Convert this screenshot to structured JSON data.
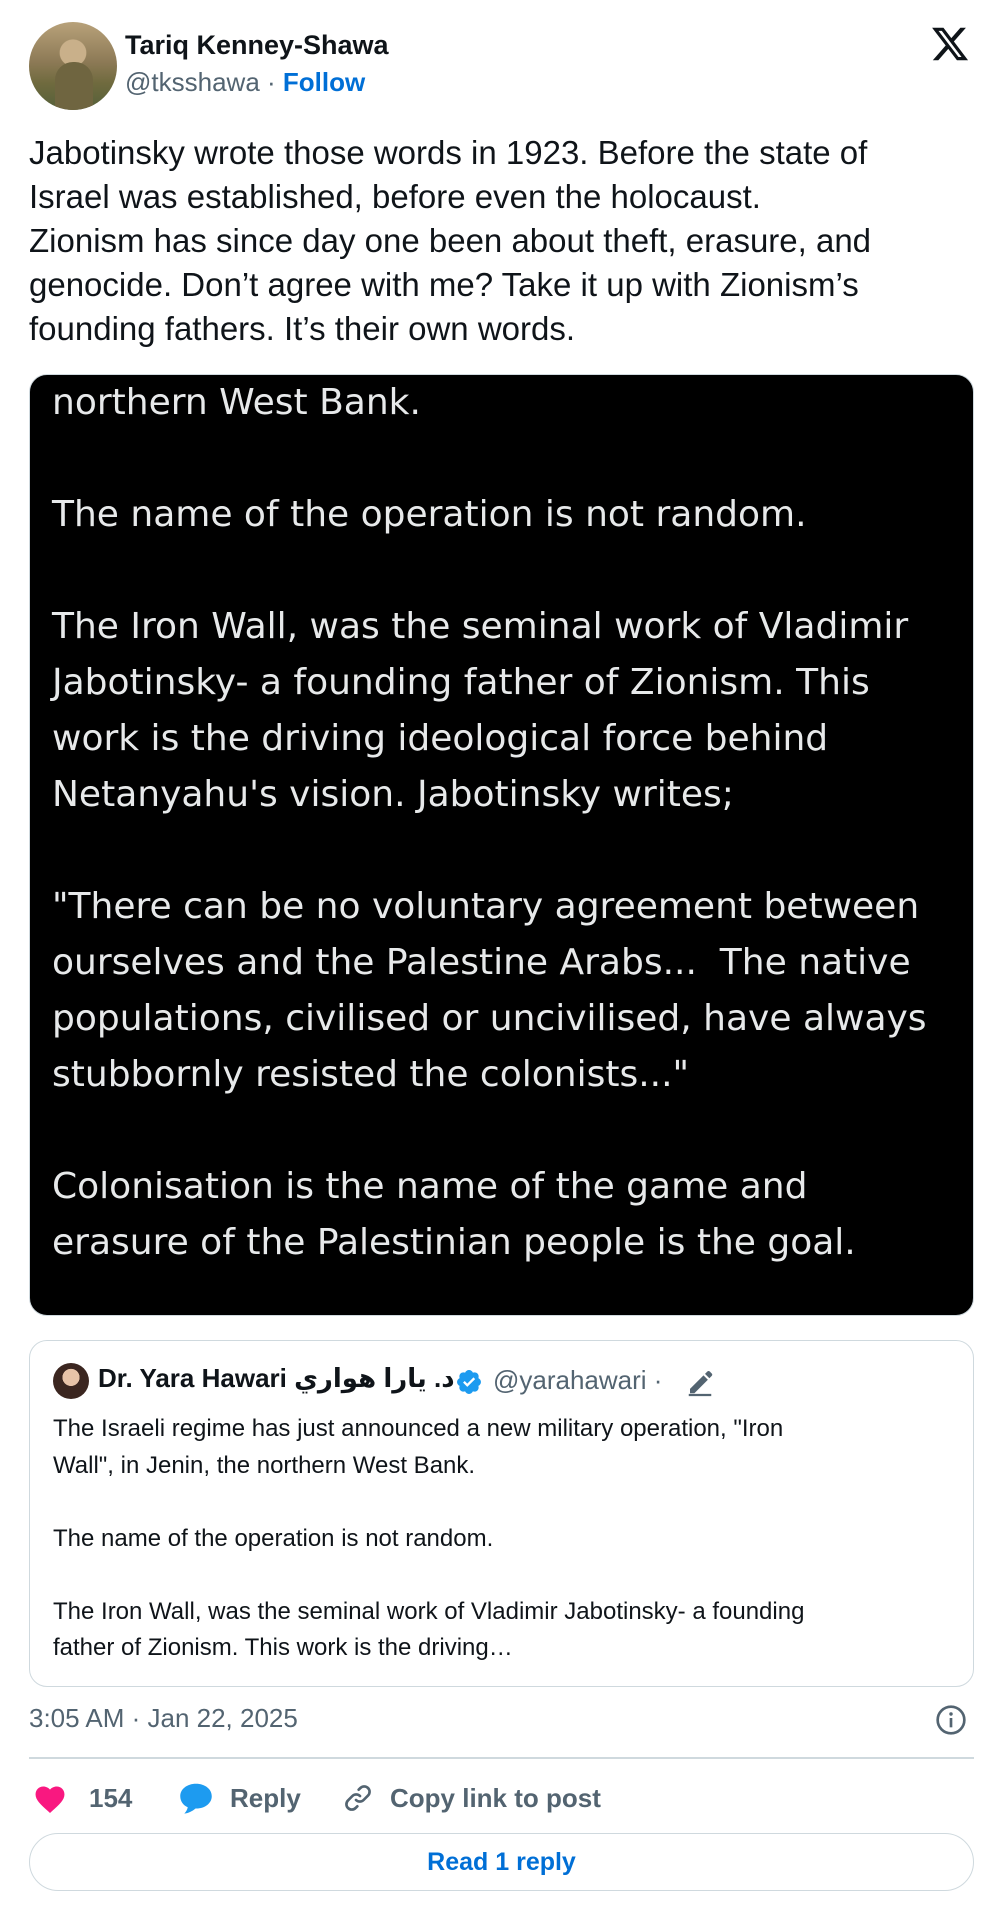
{
  "author": {
    "name": "Tariq Kenney-Shawa",
    "handle": "@tksshawa",
    "separator": "·",
    "follow_label": "Follow"
  },
  "tweet_text": "Jabotinsky wrote those words in 1923. Before the state of\nIsrael was established, before even the holocaust.\nZionism has since day one been about theft, erasure, and\ngenocide. Don’t agree with me? Take it up with Zionism’s\nfounding fathers. It’s their own words.",
  "media_text": "northern West Bank.\n\nThe name of the operation is not random.\n\nThe Iron Wall, was the seminal work of Vladimir\nJabotinsky- a founding father of Zionism. This\nwork is the driving ideological force behind\nNetanyahu's vision. Jabotinsky writes;\n\n\"There can be no voluntary agreement between\nourselves and the Palestine Arabs...  The native\npopulations, civilised or uncivilised, have always\nstubbornly resisted the colonists...\"\n\nColonisation is the name of the game and\nerasure of the Palestinian people is the goal.",
  "quote": {
    "name": "Dr. Yara Hawari د. يارا هواري",
    "handle": "@yarahawari · ",
    "text": "The Israeli regime has just announced a new military operation, \"Iron\nWall\", in Jenin, the northern West Bank.\n\nThe name of the operation is not random.\n\nThe Iron Wall, was the seminal work of Vladimir Jabotinsky- a founding\nfather of Zionism. This work is the driving…"
  },
  "timestamp": "3:05 AM · Jan 22, 2025",
  "actions": {
    "likes": "154",
    "reply_label": "Reply",
    "copy_label": "Copy link to post"
  },
  "read_replies_label": "Read 1 reply",
  "colors": {
    "link": "#006fd6",
    "heart": "#f91880",
    "reply_bubble": "#1d9bf0",
    "verified": "#1d9bf0"
  },
  "icons": [
    "x-logo-icon",
    "verified-badge-icon",
    "pencil-icon",
    "info-icon",
    "heart-icon",
    "reply-bubble-icon",
    "link-icon"
  ]
}
